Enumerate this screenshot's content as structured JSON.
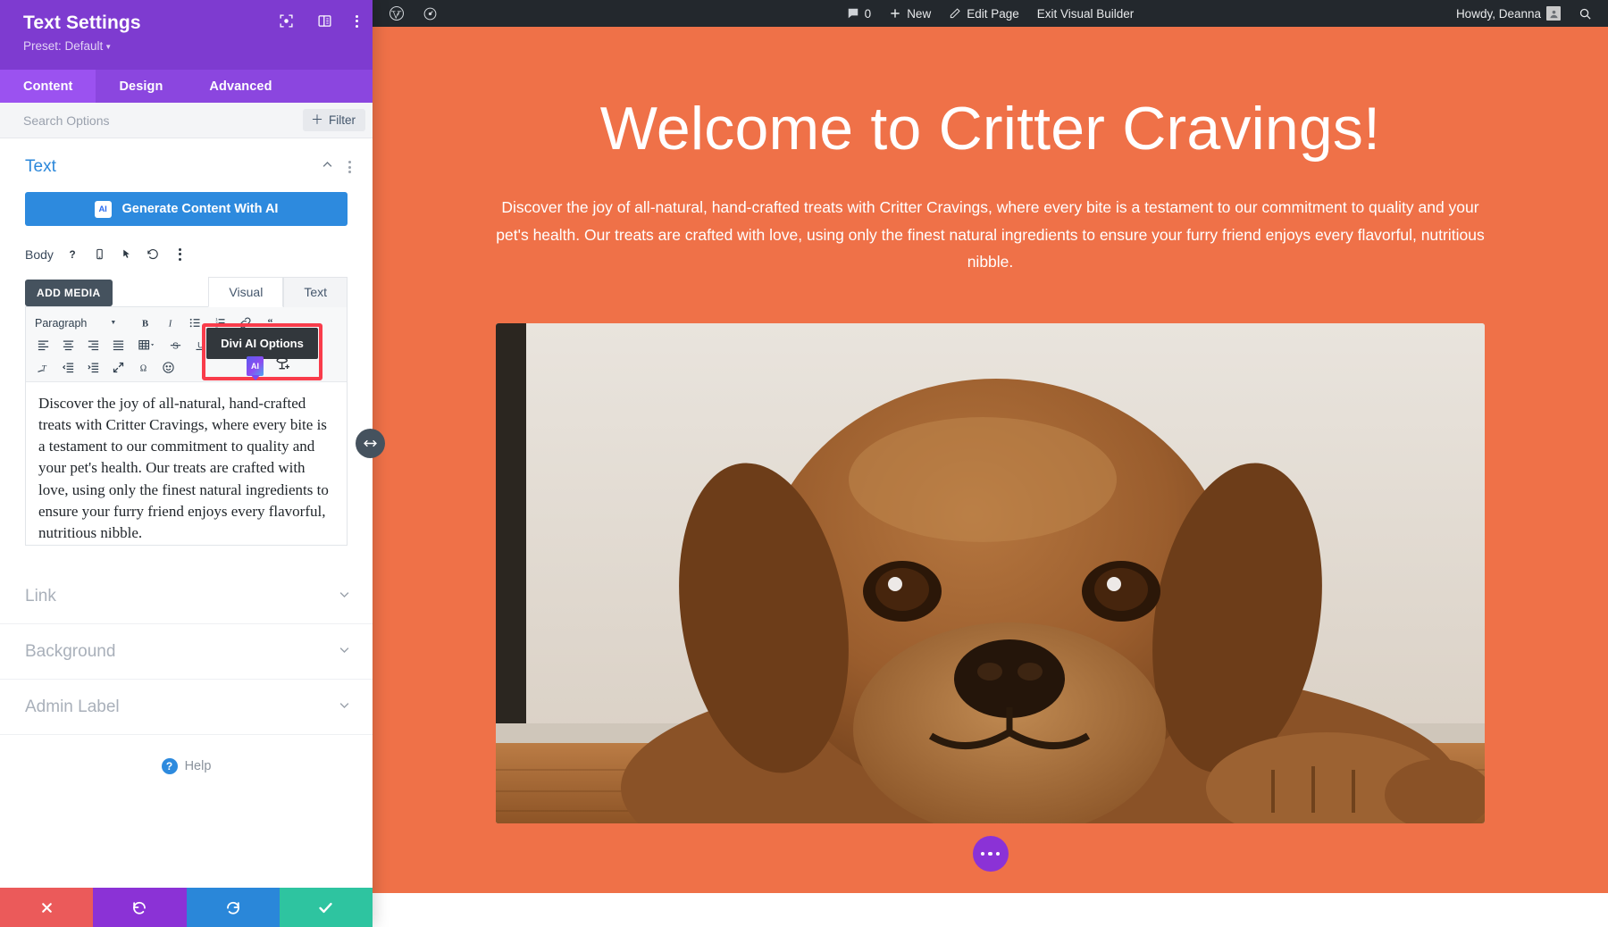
{
  "panel": {
    "title": "Text Settings",
    "preset_label": "Preset: Default",
    "header_icons": [
      "focus-target-icon",
      "layout-columns-icon",
      "kebab-menu-icon"
    ],
    "tabs": [
      {
        "label": "Content",
        "active": true
      },
      {
        "label": "Design",
        "active": false
      },
      {
        "label": "Advanced",
        "active": false
      }
    ],
    "search_placeholder": "Search Options",
    "filter_label": "Filter",
    "sections": [
      {
        "label": "Text",
        "state": "expanded"
      },
      {
        "label": "Link",
        "state": "collapsed"
      },
      {
        "label": "Background",
        "state": "collapsed"
      },
      {
        "label": "Admin Label",
        "state": "collapsed"
      }
    ],
    "generate_ai_label": "Generate Content With AI",
    "ai_chip_label": "AI",
    "body_field": {
      "label": "Body",
      "icons": [
        "help-icon",
        "responsive-icon",
        "hover-icon",
        "reset-icon",
        "kebab-menu-icon"
      ]
    },
    "add_media_label": "ADD MEDIA",
    "editor_tabs": [
      {
        "label": "Visual",
        "active": true
      },
      {
        "label": "Text",
        "active": false
      }
    ],
    "format_select_value": "Paragraph",
    "editor_content": "Discover the joy of all-natural, hand-crafted treats with Critter Cravings, where every bite is a testament to our commitment to quality and your pet's health. Our treats are crafted with love, using only the finest natural ingredients to ensure your furry friend enjoys every flavorful, nutritious nibble.",
    "help_label": "Help",
    "footer_buttons": [
      {
        "name": "discard",
        "icon": "close-icon",
        "color": "#eb5a5a"
      },
      {
        "name": "undo",
        "icon": "undo-icon",
        "color": "#8b32d6"
      },
      {
        "name": "redo",
        "icon": "redo-icon",
        "color": "#2a87d9"
      },
      {
        "name": "save",
        "icon": "check-icon",
        "color": "#2ec4a0"
      }
    ]
  },
  "tooltip": {
    "label": "Divi AI Options",
    "highlight_color": "#f93c4b",
    "ai_badge_label": "AI"
  },
  "adminbar": {
    "wp_logo": "wordpress-logo-icon",
    "dashboard": "dashboard-icon",
    "comments_count": "0",
    "new_label": "New",
    "edit_page_label": "Edit Page",
    "exit_builder_label": "Exit Visual Builder",
    "howdy_label": "Howdy, Deanna",
    "search": "search-icon"
  },
  "preview": {
    "heading": "Welcome to Critter Cravings!",
    "paragraph": "Discover the joy of all-natural, hand-crafted treats with Critter Cravings, where every bite is a testament to our commitment to quality and your pet's health. Our treats are crafted with love, using only the finest natural ingredients to ensure your furry friend enjoys every flavorful, nutritious nibble.",
    "background_color": "#ef7148",
    "image_alt": "brown-labrador-dog-lying-on-wooden-floor"
  }
}
